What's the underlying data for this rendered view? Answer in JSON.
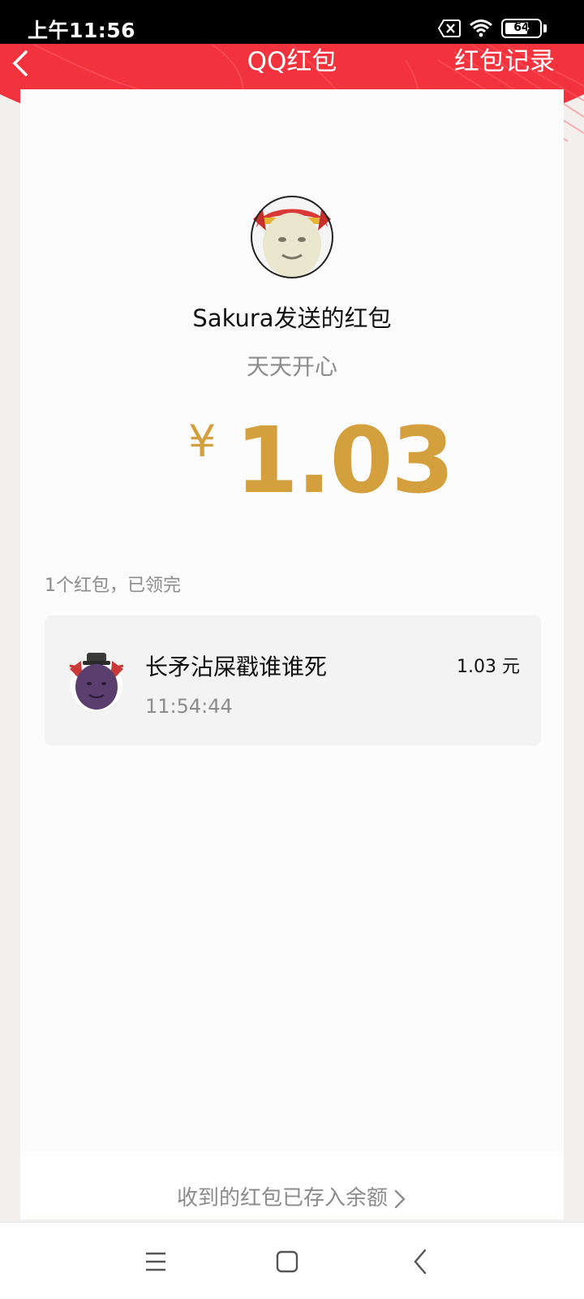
{
  "status_bar": {
    "time": "上午11:56",
    "battery": "64",
    "battery_level": 0.64,
    "icons": [
      "sim-off-icon",
      "wifi-icon",
      "battery-icon"
    ]
  },
  "header": {
    "title": "QQ红包",
    "back_icon": "chevron-left-icon",
    "record_label": "红包记录"
  },
  "packet": {
    "sender_line": "Sakura发送的红包",
    "wish": "天天开心",
    "currency": "¥",
    "amount": "1.03",
    "summary": "1个红包，已领完"
  },
  "receivers": [
    {
      "name": "长矛沾屎戳谁谁死",
      "time": "11:54:44",
      "amount": "1.03 元"
    }
  ],
  "footer": {
    "balance_link": "收到的红包已存入余额"
  },
  "nav": {
    "icons": [
      "menu-icon",
      "home-icon",
      "back-icon"
    ]
  },
  "colors": {
    "header_red": "#f2333e",
    "gold": "#d4a03d",
    "grey_text": "#8c8c8c"
  }
}
